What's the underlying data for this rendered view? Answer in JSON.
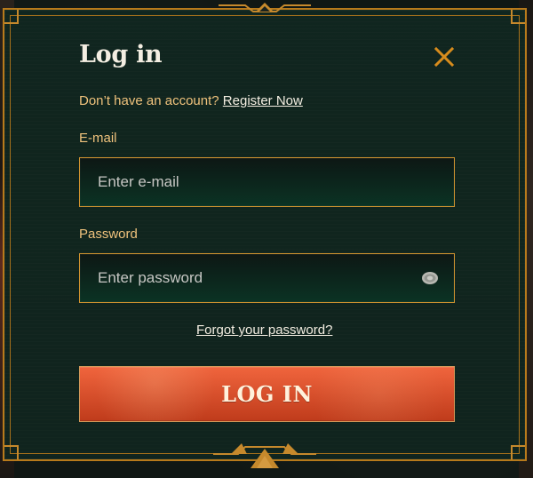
{
  "title": "Log in",
  "register_prompt": {
    "text": "Don’t have an account?",
    "link": "Register Now"
  },
  "fields": {
    "email": {
      "label": "E-mail",
      "value": "",
      "placeholder": "Enter e-mail"
    },
    "password": {
      "label": "Password",
      "value": "",
      "placeholder": "Enter password"
    }
  },
  "links": {
    "forgot_password": "Forgot your password?"
  },
  "actions": {
    "login_label": "LOG IN"
  },
  "icons": {
    "close": "close-icon",
    "password_toggle": "eye-icon",
    "top_ornament": "ornament-icon",
    "bottom_ornament": "ornament-icon"
  },
  "colors": {
    "accent": "#c6892c",
    "text_primary": "#f4eee2",
    "text_secondary": "#efc27c",
    "modal_bg": "#112720",
    "input_bg_bottom": "#0b3324",
    "button_primary": "#e3512a"
  }
}
